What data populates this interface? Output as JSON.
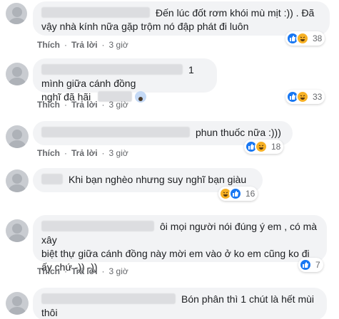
{
  "labels": {
    "like": "Thích",
    "reply": "Trả lời",
    "sep": "·"
  },
  "colors": {
    "like": "#1877f2",
    "haha": "#f7b125",
    "bubble": "#f2f3f5",
    "meta": "#65676b"
  },
  "comments": [
    {
      "lines": [
        "Đến lúc đốt rơm khói mù mịt :)) . Đã",
        "vậy nhà kính nữa gặp trộm nó đập phát đi luôn"
      ],
      "reactions": [
        "like",
        "haha"
      ],
      "count": "38",
      "time": "3 giờ"
    },
    {
      "lines": [
        "1 mình giữa cánh đồng",
        "nghĩ đã hãi"
      ],
      "reactions": [
        "like",
        "haha"
      ],
      "count": "33",
      "time": "3 giờ",
      "emoji": "scared-face-icon"
    },
    {
      "lines": [
        "phun thuốc nữa :)))"
      ],
      "reactions": [
        "like",
        "haha"
      ],
      "count": "18",
      "time": "3 giờ"
    },
    {
      "lines": [
        "Khi bạn nghèo nhưng suy nghĩ bạn giàu"
      ],
      "reactions": [
        "haha",
        "like"
      ],
      "count": "16",
      "time": "3 giờ"
    },
    {
      "lines": [
        "ôi mọi người nói đúng ý em , có mà xây",
        "biệt thự giữa cánh đồng này mời em vào ở ko em cũng ko đi",
        "ấy chứ -)) -))"
      ],
      "reactions": [
        "like"
      ],
      "count": "7",
      "time": "3 giờ"
    },
    {
      "lines": [
        "Bón phân thì 1 chút là hết mùi",
        "thôi"
      ],
      "reactions": [],
      "count": "",
      "time": ""
    }
  ]
}
